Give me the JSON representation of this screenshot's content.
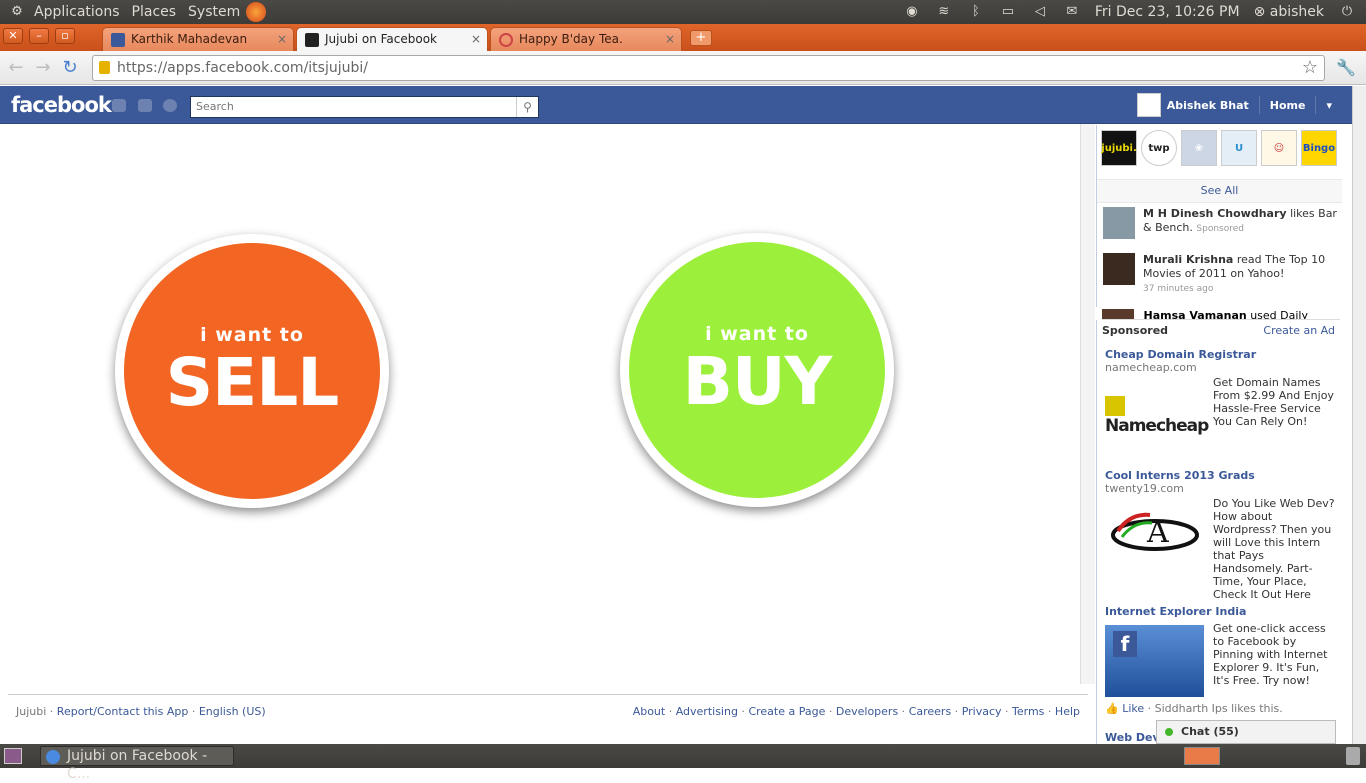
{
  "system_panel": {
    "menus": [
      "Applications",
      "Places",
      "System"
    ],
    "clock": "Fri Dec 23, 10:26 PM",
    "user": "abishek"
  },
  "browser": {
    "tabs": [
      {
        "title": "Karthik Mahadevan",
        "active": false
      },
      {
        "title": "Jujubi on Facebook",
        "active": true
      },
      {
        "title": "Happy B'day Tea.",
        "active": false
      }
    ],
    "url": "https://apps.facebook.com/itsjujubi/"
  },
  "facebook": {
    "logo": "facebook",
    "search_placeholder": "Search",
    "user_name": "Abishek Bhat",
    "home": "Home"
  },
  "app": {
    "sell": {
      "small": "i want to",
      "big": "SELL",
      "color": "#f26522"
    },
    "buy": {
      "small": "i want to",
      "big": "BUY",
      "color": "#9cf03c"
    }
  },
  "footer": {
    "app_name": "Jujubi",
    "report": "Report/Contact this App",
    "language": "English (US)",
    "links": [
      "About",
      "Advertising",
      "Create a Page",
      "Developers",
      "Careers",
      "Privacy",
      "Terms",
      "Help"
    ]
  },
  "ticker": {
    "app_icons": [
      "jujubi.",
      "twp",
      "",
      "U",
      "",
      "Bingo"
    ],
    "see_all": "See All",
    "stories": [
      {
        "name": "M H Dinesh Chowdhary",
        "text": "likes Bar & Bench.",
        "meta": "Sponsored"
      },
      {
        "name": "Murali Krishna",
        "text": "read The Top 10 Movies of 2011 on Yahoo!",
        "meta": "37 minutes ago"
      },
      {
        "name": "Hamsa Vamanan",
        "text": "used Daily",
        "meta": ""
      }
    ]
  },
  "sponsored": {
    "heading": "Sponsored",
    "create_ad": "Create an Ad",
    "ads": [
      {
        "title": "Cheap Domain Registrar",
        "url": "namecheap.com",
        "body": "Get Domain Names From $2.99 And Enjoy Hassle-Free Service You Can Rely On!",
        "image_text": "Namecheap"
      },
      {
        "title": "Cool Interns 2013 Grads",
        "url": "twenty19.com",
        "body": "Do You Like Web Dev? How about Wordpress? Then you will Love this Intern that Pays Handsomely. Part-Time, Your Place, Check It Out Here",
        "image_text": "A"
      },
      {
        "title": "Internet Explorer India",
        "url": "",
        "body": "Get one-click access to Facebook by Pinning with Internet Explorer 9. It's Fun, It's Free. Try now!",
        "image_text": "f"
      }
    ],
    "like": "Like",
    "like_by": "Siddharth Ips likes this.",
    "next_ad_title": "Web Devs"
  },
  "chat": {
    "label": "Chat",
    "count": "(55)"
  },
  "taskbar": {
    "window": "Jujubi on Facebook - C..."
  }
}
